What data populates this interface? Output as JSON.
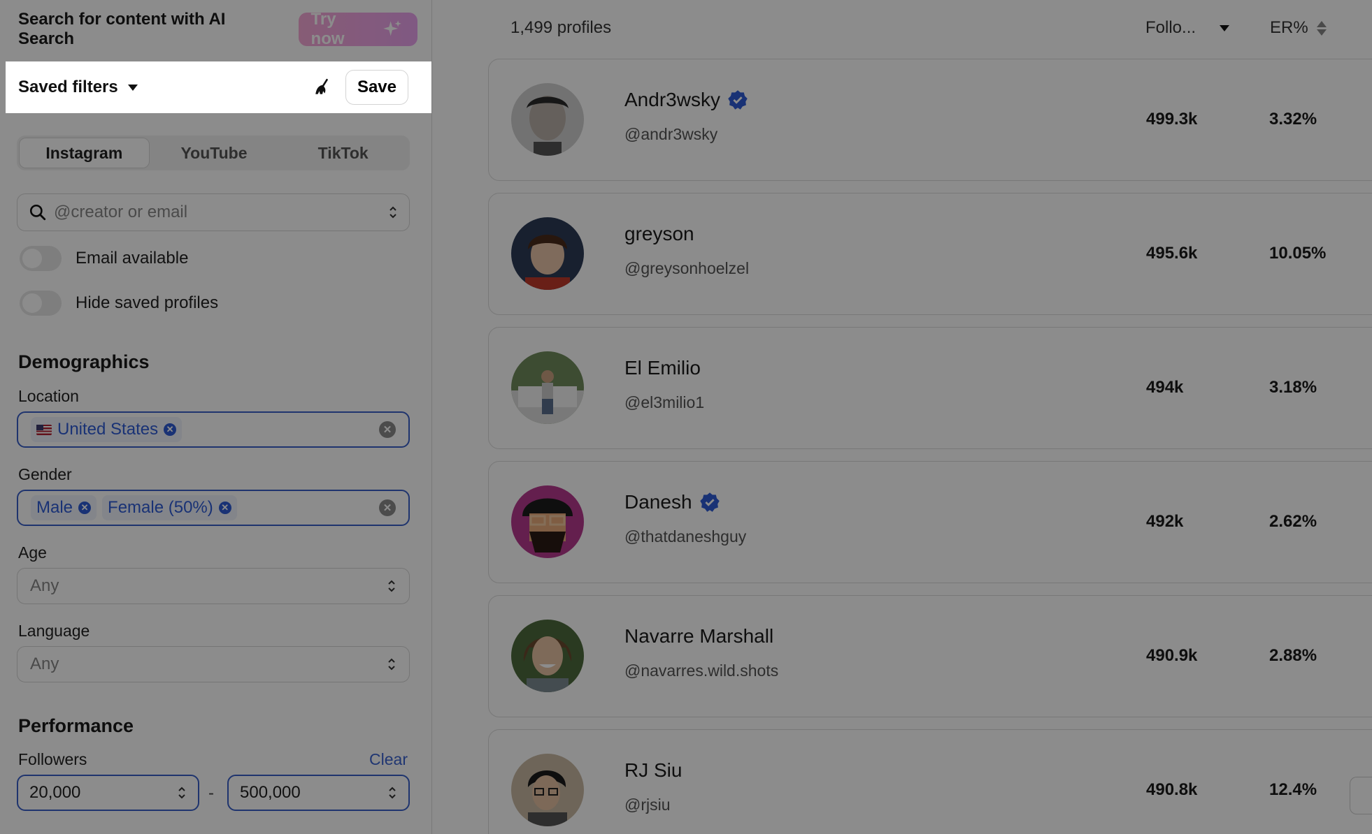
{
  "sidebar": {
    "ai_search_text": "Search for content with AI Search",
    "try_now_label": "Try now",
    "saved_filters_label": "Saved filters",
    "save_label": "Save",
    "tabs": [
      {
        "label": "Instagram",
        "active": true
      },
      {
        "label": "YouTube",
        "active": false
      },
      {
        "label": "TikTok",
        "active": false
      }
    ],
    "search_placeholder": "@creator or email",
    "toggles": {
      "email_available": "Email available",
      "hide_saved": "Hide saved profiles"
    },
    "demographics": {
      "title": "Demographics",
      "location_label": "Location",
      "location_chips": [
        "United States"
      ],
      "gender_label": "Gender",
      "gender_chips": [
        "Male",
        "Female (50%)"
      ],
      "age_label": "Age",
      "age_value": "Any",
      "language_label": "Language",
      "language_value": "Any"
    },
    "performance": {
      "title": "Performance",
      "followers_label": "Followers",
      "clear_label": "Clear",
      "followers_min": "20,000",
      "followers_max": "500,000",
      "dash": "-"
    }
  },
  "main": {
    "count": "1,499 profiles",
    "col_followers": "Follo...",
    "col_er": "ER%",
    "profiles": [
      {
        "name": "Andr3wsky",
        "handle": "@andr3wsky",
        "followers": "499.3k",
        "er": "3.32%",
        "verified": true
      },
      {
        "name": "greyson",
        "handle": "@greysonhoelzel",
        "followers": "495.6k",
        "er": "10.05%",
        "verified": false
      },
      {
        "name": "El Emilio",
        "handle": "@el3milio1",
        "followers": "494k",
        "er": "3.18%",
        "verified": false
      },
      {
        "name": "Danesh",
        "handle": "@thatdaneshguy",
        "followers": "492k",
        "er": "2.62%",
        "verified": true
      },
      {
        "name": "Navarre Marshall",
        "handle": "@navarres.wild.shots",
        "followers": "490.9k",
        "er": "2.88%",
        "verified": false
      },
      {
        "name": "RJ Siu",
        "handle": "@rjsiu",
        "followers": "490.8k",
        "er": "12.4%",
        "verified": false
      }
    ]
  },
  "colors": {
    "accent": "#3960c9",
    "try_now_gradient_start": "#f6a8d6",
    "try_now_gradient_end": "#e9a2ee",
    "overlay": "rgba(0,0,0,0.45)"
  }
}
